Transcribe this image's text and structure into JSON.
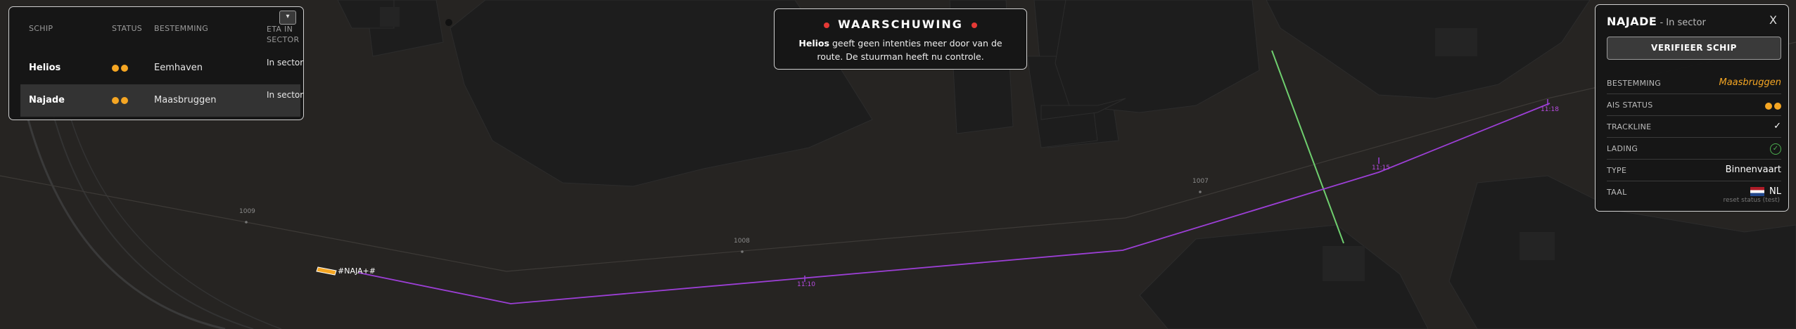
{
  "map": {
    "ship_label": "#NAJA+#",
    "waypoints": [
      "1009",
      "1008",
      "1007"
    ],
    "times": [
      "11:10",
      "11:15",
      "11:18"
    ]
  },
  "ship_list": {
    "dropdown_icon": "chevron-down-icon",
    "headers": {
      "ship": "SCHIP",
      "status": "STATUS",
      "destination": "BESTEMMING",
      "eta": "ETA IN SECTOR"
    },
    "rows": [
      {
        "name": "Helios",
        "destination": "Eemhaven",
        "eta": "In sector"
      },
      {
        "name": "Najade",
        "destination": "Maasbruggen",
        "eta": "In sector"
      }
    ],
    "status_color": "#f5a623"
  },
  "warning": {
    "title": "WAARSCHUWING",
    "ship": "Helios",
    "message": "geeft geen intenties meer door van de route. De stuurman heeft nu controle."
  },
  "detail": {
    "name": "NAJADE",
    "separator": " - ",
    "status": "In sector",
    "close": "X",
    "verify_button": "VERIFIEER SCHIP",
    "rows": {
      "destination_label": "BESTEMMING",
      "destination_value": "Maasbruggen",
      "ais_label": "AIS STATUS",
      "trackline_label": "TRACKLINE",
      "cargo_label": "LADING",
      "type_label": "TYPE",
      "type_value": "Binnenvaart",
      "language_label": "TAAL",
      "language_value": "NL"
    },
    "reset_link": "reset status (test)"
  },
  "colors": {
    "route": "#9c3fd6",
    "accent": "#f5a623",
    "ok": "#4caf50",
    "alert": "#e53935",
    "heading_line": "#6fcf6f"
  }
}
